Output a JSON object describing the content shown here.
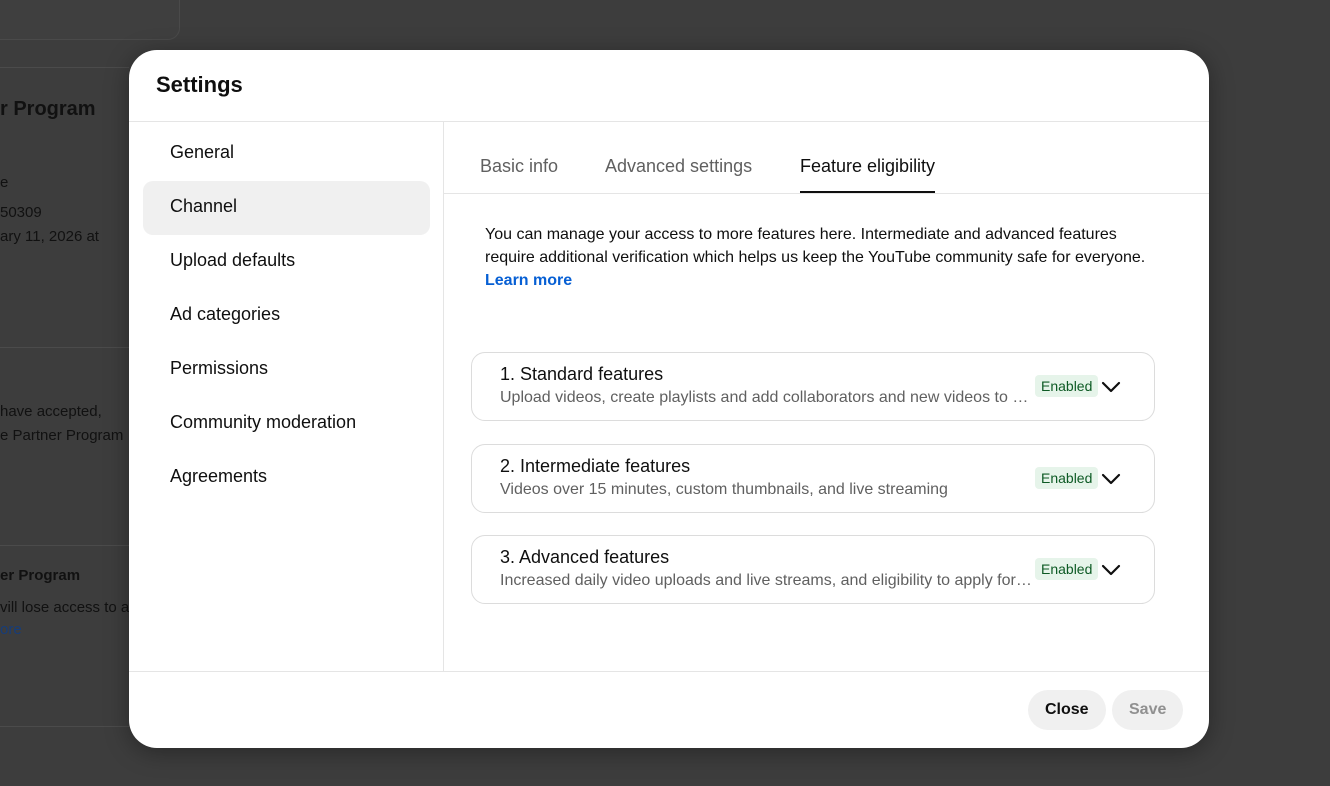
{
  "background": {
    "program_title_fragment": "r Program",
    "line_e": "e",
    "line_id": "50309",
    "line_date": "ary 11, 2026 at",
    "line_accepted": "have accepted,",
    "line_partner": "e Partner Program",
    "section_title": "er Program",
    "line_lose": "vill lose access to a",
    "link_more": "ore"
  },
  "modal": {
    "title": "Settings",
    "sidebar": {
      "items": [
        {
          "label": "General"
        },
        {
          "label": "Channel"
        },
        {
          "label": "Upload defaults"
        },
        {
          "label": "Ad categories"
        },
        {
          "label": "Permissions"
        },
        {
          "label": "Community moderation"
        },
        {
          "label": "Agreements"
        }
      ],
      "active_item": "Channel"
    },
    "tabs": [
      {
        "label": "Basic info"
      },
      {
        "label": "Advanced settings"
      },
      {
        "label": "Feature eligibility"
      }
    ],
    "active_tab": "Feature eligibility",
    "intro": {
      "text": "You can manage your access to more features here. Intermediate and advanced features require additional verification which helps us keep the YouTube community safe for everyone.",
      "link": "Learn more"
    },
    "features": [
      {
        "title": "1. Standard features",
        "description": "Upload videos, create playlists and add collaborators and new videos to playlists",
        "status": "Enabled"
      },
      {
        "title": "2. Intermediate features",
        "description": "Videos over 15 minutes, custom thumbnails, and live streaming",
        "status": "Enabled"
      },
      {
        "title": "3. Advanced features",
        "description": "Increased daily video uploads and live streams, and eligibility to apply for YouTube Partner Program",
        "status": "Enabled"
      }
    ],
    "footer": {
      "close_label": "Close",
      "save_label": "Save"
    }
  },
  "colors": {
    "overlay": "#3d3d3d",
    "link": "#065fd4",
    "badge_bg": "#e6f4ea",
    "badge_text": "#0d5a24"
  },
  "icons": {
    "expand": "chevron-down-icon"
  }
}
